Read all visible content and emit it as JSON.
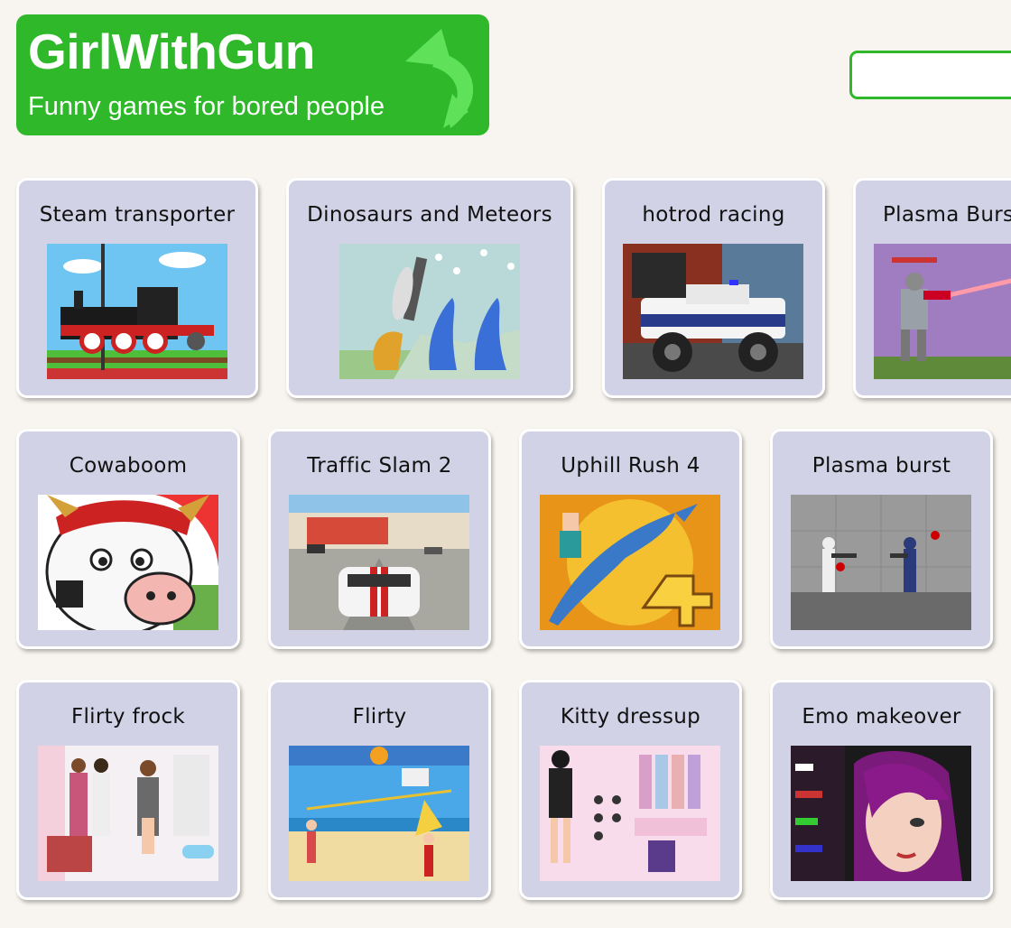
{
  "site": {
    "title": "GirlWithGun",
    "tagline": "Funny games for bored people",
    "brand_color": "#2eb82a",
    "logo_icon": "curved-arrow-icon"
  },
  "search": {
    "value": "",
    "placeholder": ""
  },
  "games": [
    {
      "title": "Steam transporter",
      "thumb": "steam-locomotive"
    },
    {
      "title": "Dinosaurs and Meteors",
      "thumb": "dinosaurs-meteors"
    },
    {
      "title": "hotrod racing",
      "thumb": "police-monster-truck"
    },
    {
      "title": "Plasma Burst",
      "thumb": "robot-soldier-laser"
    },
    {
      "title": "Cowaboom",
      "thumb": "angry-cow"
    },
    {
      "title": "Traffic Slam 2",
      "thumb": "racing-car"
    },
    {
      "title": "Uphill Rush 4",
      "thumb": "girl-riding-dolphin"
    },
    {
      "title": "Plasma burst",
      "thumb": "gunfight-corridor"
    },
    {
      "title": "Flirty frock",
      "thumb": "dressup-girls"
    },
    {
      "title": "Flirty",
      "thumb": "beach-volleyball"
    },
    {
      "title": "Kitty dressup",
      "thumb": "dressup-wardrobe"
    },
    {
      "title": "Emo makeover",
      "thumb": "emo-girl-portrait"
    }
  ]
}
